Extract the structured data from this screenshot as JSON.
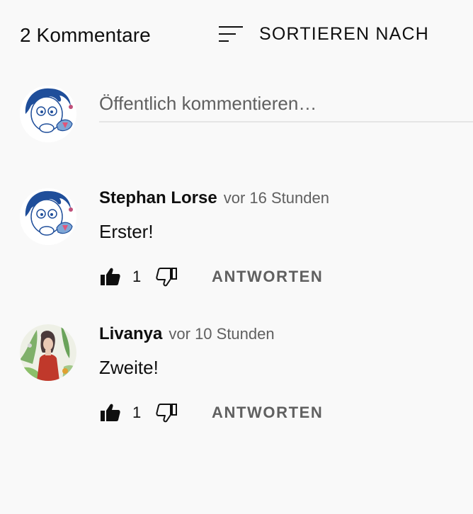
{
  "header": {
    "comment_count": "2 Kommentare",
    "sort_label": "SORTIEREN NACH"
  },
  "composer": {
    "placeholder": "Öffentlich kommentieren…"
  },
  "comments": [
    {
      "author": "Stephan Lorse",
      "time": "vor 16 Stunden",
      "text": "Erster!",
      "likes": "1",
      "reply_label": "ANTWORTEN"
    },
    {
      "author": "Livanya",
      "time": "vor 10 Stunden",
      "text": "Zweite!",
      "likes": "1",
      "reply_label": "ANTWORTEN"
    }
  ],
  "icons": {
    "sort": "sort-icon",
    "like": "thumbs-up-icon",
    "dislike": "thumbs-down-icon"
  },
  "colors": {
    "background": "#f9f9f9",
    "primary_text": "#0f0f0f",
    "secondary_text": "#606060",
    "avatar_blue": "#1f4e9a"
  }
}
